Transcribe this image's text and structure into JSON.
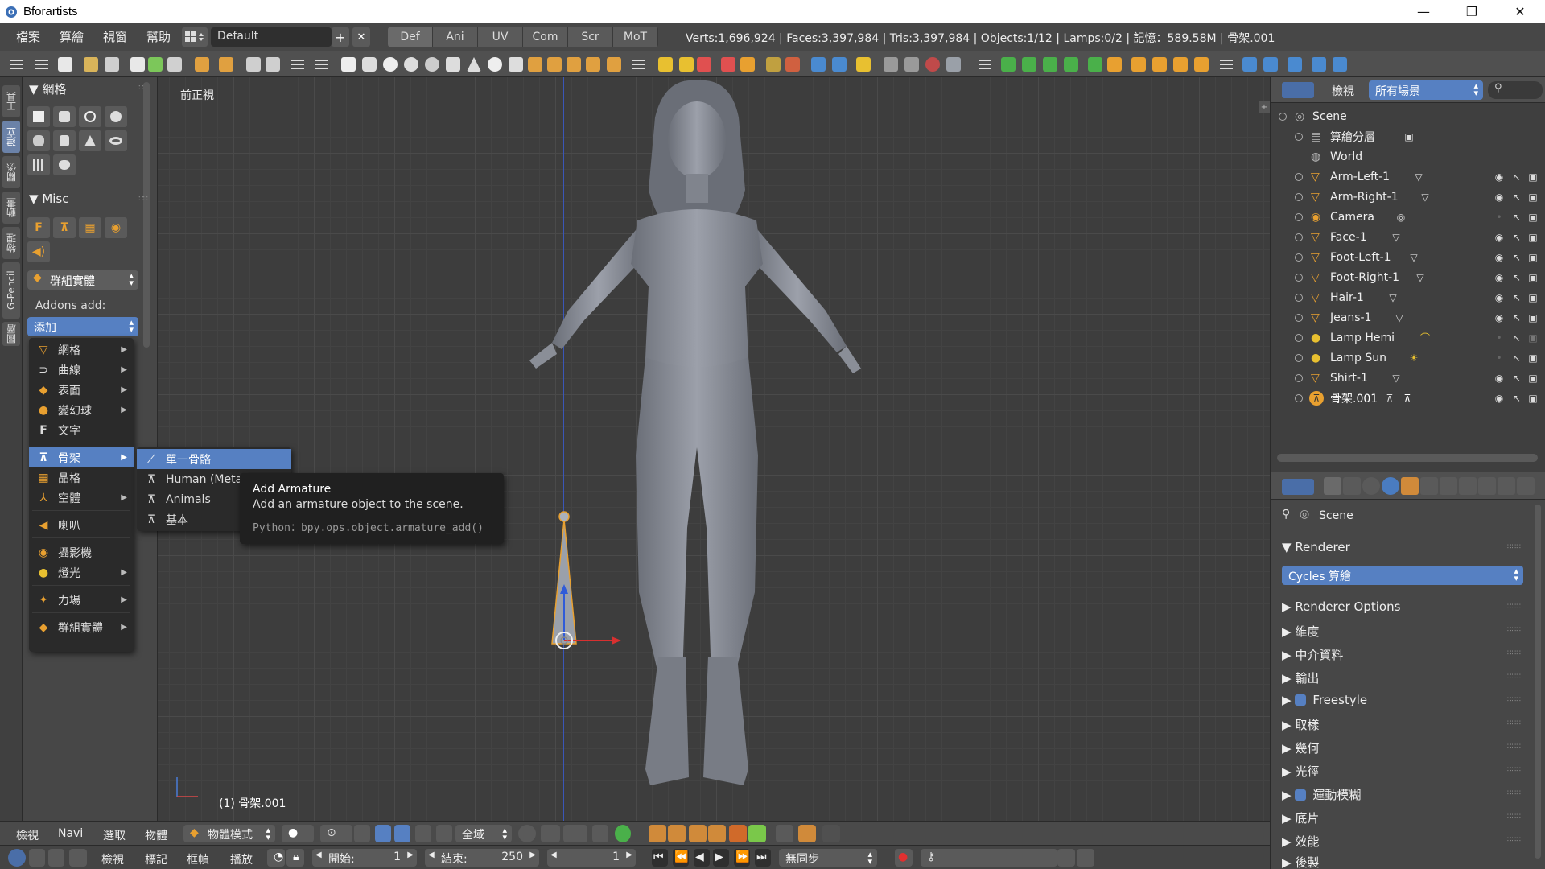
{
  "window": {
    "title": "Bforartists",
    "minimize": "—",
    "maximize": "❐",
    "close": "✕"
  },
  "info_header": {
    "menus": [
      "檔案",
      "算繪",
      "視窗",
      "幫助"
    ],
    "layout_name": "Default",
    "add_btn": "+",
    "remove_btn": "✕",
    "workspaces": [
      "Def",
      "Ani",
      "UV",
      "Com",
      "Scr",
      "MoT"
    ],
    "stats": "Verts:1,696,924 | Faces:3,397,984 | Tris:3,397,984 | Objects:1/12 | Lamps:0/2 | 記憶：589.58M | 骨架.001"
  },
  "left_tabs": [
    "工具",
    "建立",
    "關係",
    "動畫",
    "物理",
    "G-Pencil",
    "圖層"
  ],
  "tool_shelf": {
    "mesh_panel": "網格",
    "misc_panel": "Misc",
    "group_instance": "群組實體",
    "addons_label": "Addons add:",
    "add_dropdown": "添加"
  },
  "add_menu": {
    "items": [
      {
        "label": "網格",
        "icon": "mesh-icon",
        "sub": true
      },
      {
        "label": "曲線",
        "icon": "curve-icon",
        "sub": true
      },
      {
        "label": "表面",
        "icon": "surface-icon",
        "sub": true
      },
      {
        "label": "變幻球",
        "icon": "metaball-icon",
        "sub": true
      },
      {
        "label": "文字",
        "icon": "text-icon",
        "sub": false
      },
      {
        "label": "骨架",
        "icon": "armature-icon",
        "sub": true
      },
      {
        "label": "晶格",
        "icon": "lattice-icon",
        "sub": false
      },
      {
        "label": "空體",
        "icon": "empty-icon",
        "sub": true
      },
      {
        "label": "喇叭",
        "icon": "speaker-icon",
        "sub": false
      },
      {
        "label": "攝影機",
        "icon": "camera-icon",
        "sub": false
      },
      {
        "label": "燈光",
        "icon": "lamp-icon",
        "sub": true
      },
      {
        "label": "力場",
        "icon": "forcefield-icon",
        "sub": true
      },
      {
        "label": "群組實體",
        "icon": "group-icon",
        "sub": true
      }
    ]
  },
  "armature_submenu": {
    "items": [
      "單一骨骼",
      "Human (Meta-Rig)",
      "Animals",
      "基本"
    ]
  },
  "tooltip": {
    "title": "Add Armature",
    "description": "Add an armature object to the scene.",
    "python": "Python：bpy.ops.object.armature_add()"
  },
  "viewport": {
    "view_label": "前正視",
    "active_object": "(1) 骨架.001"
  },
  "outliner": {
    "view_menu": "檢視",
    "scene_filter": "所有場景",
    "rows": [
      {
        "name": "Scene",
        "level": 0
      },
      {
        "name": "算繪分層",
        "level": 1
      },
      {
        "name": "World",
        "level": 1
      },
      {
        "name": "Arm-Left-1",
        "level": 1
      },
      {
        "name": "Arm-Right-1",
        "level": 1
      },
      {
        "name": "Camera",
        "level": 1
      },
      {
        "name": "Face-1",
        "level": 1
      },
      {
        "name": "Foot-Left-1",
        "level": 1
      },
      {
        "name": "Foot-Right-1",
        "level": 1
      },
      {
        "name": "Hair-1",
        "level": 1
      },
      {
        "name": "Jeans-1",
        "level": 1
      },
      {
        "name": "Lamp Hemi",
        "level": 1
      },
      {
        "name": "Lamp Sun",
        "level": 1
      },
      {
        "name": "Shirt-1",
        "level": 1
      },
      {
        "name": "骨架.001",
        "level": 1
      }
    ]
  },
  "properties": {
    "context": "Scene",
    "renderer_panel": "Renderer",
    "render_engine": "Cycles 算繪",
    "panels": [
      "Renderer Options",
      "維度",
      "中介資料",
      "輸出",
      "Freestyle",
      "取樣",
      "幾何",
      "光徑",
      "運動模糊",
      "底片",
      "效能",
      "後製"
    ]
  },
  "viewport_header": {
    "menus": [
      "檢視",
      "Navi",
      "選取",
      "物體"
    ],
    "mode": "物體模式",
    "pivot": "全域"
  },
  "timeline": {
    "menus": [
      "檢視",
      "標記",
      "框幀",
      "播放"
    ],
    "start_label": "開始:",
    "start_value": "1",
    "end_label": "結束:",
    "end_value": "250",
    "current_frame": "1",
    "sync": "無同步"
  },
  "colors": {
    "accent": "#5680c2",
    "panel": "#474747",
    "viewport": "#3d3d3d"
  }
}
